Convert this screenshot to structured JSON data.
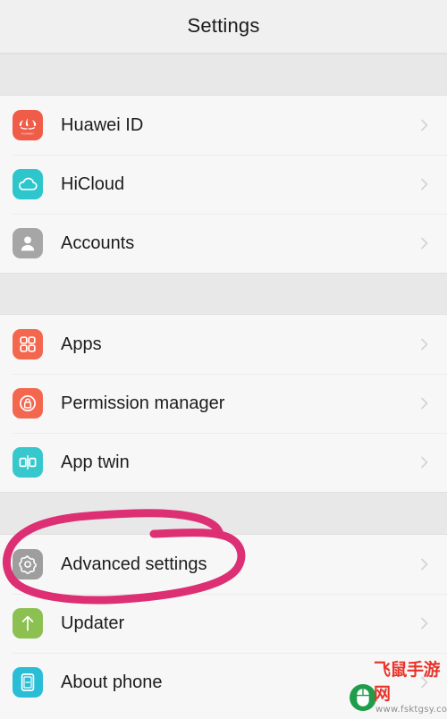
{
  "header": {
    "title": "Settings"
  },
  "groups": [
    {
      "id": "account-group",
      "items": [
        {
          "label": "Huawei ID",
          "icon": "huawei-logo-icon",
          "icon_bg": "#ef5c48"
        },
        {
          "label": "HiCloud",
          "icon": "cloud-icon",
          "icon_bg": "#2ec6cd"
        },
        {
          "label": "Accounts",
          "icon": "person-icon",
          "icon_bg": "#a6a6a6"
        }
      ]
    },
    {
      "id": "apps-group",
      "items": [
        {
          "label": "Apps",
          "icon": "grid-apps-icon",
          "icon_bg": "#f4674f"
        },
        {
          "label": "Permission manager",
          "icon": "lock-circle-icon",
          "icon_bg": "#f4674f"
        },
        {
          "label": "App twin",
          "icon": "app-twin-icon",
          "icon_bg": "#36c8cd"
        }
      ]
    },
    {
      "id": "system-group",
      "items": [
        {
          "label": "Advanced settings",
          "icon": "gear-icon",
          "icon_bg": "#9e9e9e"
        },
        {
          "label": "Updater",
          "icon": "up-arrow-icon",
          "icon_bg": "#8cc152"
        },
        {
          "label": "About phone",
          "icon": "phone-info-icon",
          "icon_bg": "#29bdd6"
        }
      ]
    }
  ],
  "annotation": {
    "type": "hand-drawn-ellipse",
    "target_label": "Advanced settings",
    "color": "#dd2f73"
  },
  "watermark": {
    "text": "飞鼠手游网",
    "url": "www.fsktgsy.com",
    "logo_color": "#1f9d4a",
    "text_color": "#e8342a"
  },
  "chevron": {
    "icon": "chevron-right-icon",
    "color": "#cfcfcf"
  }
}
